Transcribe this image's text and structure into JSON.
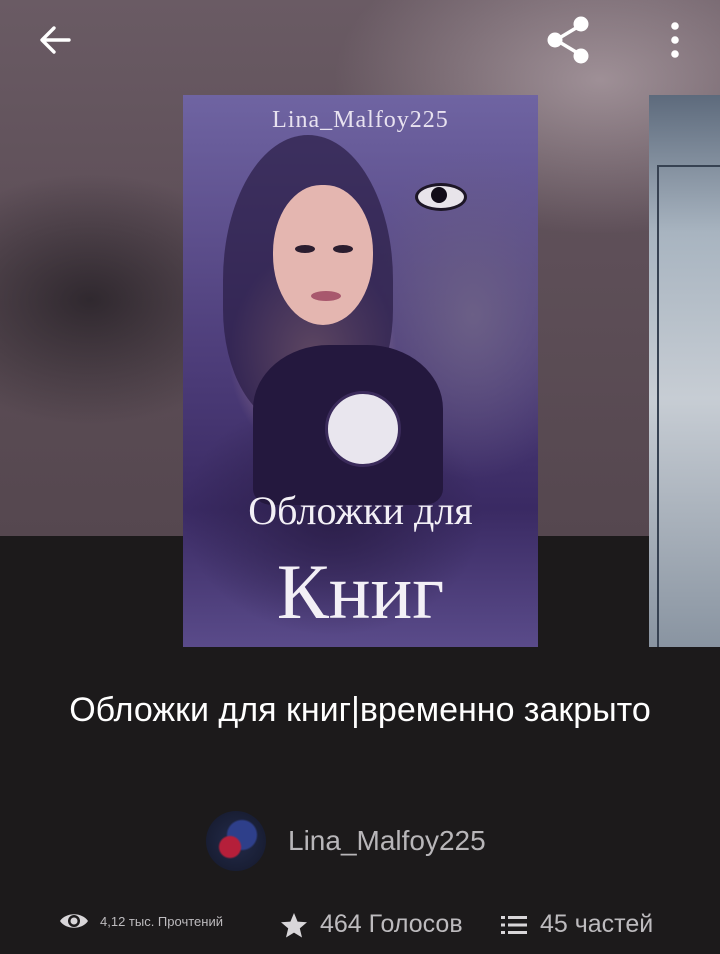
{
  "header": {
    "back_icon": "arrow-left-icon",
    "share_icon": "share-icon",
    "more_icon": "more-vertical-icon"
  },
  "cover": {
    "author_text": "Lina_Malfoy225",
    "title_line1": "Обложки для",
    "title_line2": "Книг"
  },
  "story": {
    "title": "Обложки для книг|временно закрыто",
    "author": "Lina_Malfoy225"
  },
  "stats": {
    "reads": "4,12 тыс. Прочтений",
    "votes": "464 Голосов",
    "parts": "45 частей"
  },
  "colors": {
    "background": "#1c1a1b",
    "hero": "#5f5059",
    "text_primary": "#ffffff",
    "text_secondary": "#bdbbbe"
  }
}
